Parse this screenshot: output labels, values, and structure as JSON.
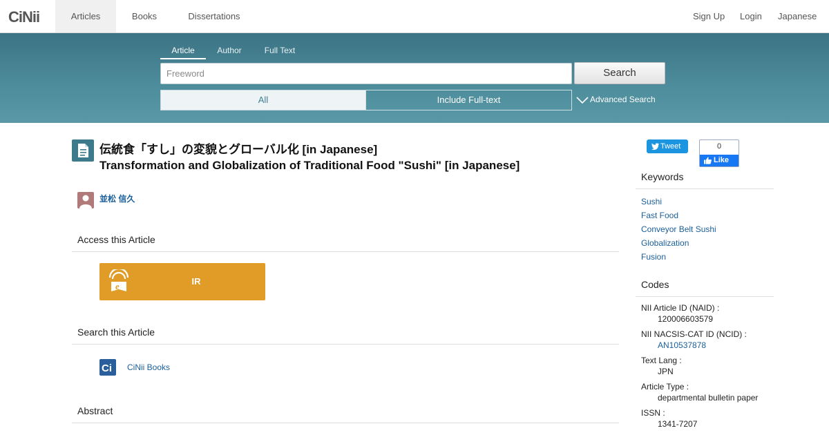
{
  "nav": {
    "logo": "CiNii",
    "tabs": [
      {
        "label": "Articles"
      },
      {
        "label": "Books"
      },
      {
        "label": "Dissertations"
      }
    ],
    "right_links": [
      {
        "label": "Sign Up"
      },
      {
        "label": "Login"
      },
      {
        "label": "Japanese"
      }
    ]
  },
  "search": {
    "tabs": [
      {
        "label": "Article"
      },
      {
        "label": "Author"
      },
      {
        "label": "Full Text"
      }
    ],
    "placeholder": "Freeword",
    "button": "Search",
    "filters": {
      "all": "All",
      "full_text": "Include Full-text"
    },
    "advanced": "Advanced Search"
  },
  "article": {
    "title_ja": "伝統食「すし」の変貌とグローバル化 [in Japanese]",
    "title_en": "Transformation and Globalization of Traditional Food \"Sushi\" [in Japanese]",
    "author": "並松 信久"
  },
  "sections": {
    "access": "Access this Article",
    "ir_label": "IR",
    "search_this": "Search this Article",
    "cinii_books": "CiNii Books",
    "abstract": "Abstract"
  },
  "social": {
    "tweet": "Tweet",
    "like_count": "0",
    "like": "Like"
  },
  "keywords": {
    "heading": "Keywords",
    "items": [
      "Sushi",
      "Fast Food",
      "Conveyor Belt Sushi",
      "Globalization",
      "Fusion"
    ]
  },
  "codes": {
    "heading": "Codes",
    "items": [
      {
        "label": "NII Article ID (NAID) :",
        "value": "120006603579"
      },
      {
        "label": "NII NACSIS-CAT ID (NCID) :",
        "value": "AN10537878"
      },
      {
        "label": "Text Lang :",
        "value": "JPN"
      },
      {
        "label": "Article Type :",
        "value": "departmental bulletin paper"
      },
      {
        "label": "ISSN :",
        "value": "1341-7207"
      }
    ]
  },
  "colors": {
    "band": "#4d8d9c",
    "ir_button": "#e09c26",
    "link": "#1a5e9a",
    "tweet": "#1b95e0",
    "like": "#1877f2"
  }
}
